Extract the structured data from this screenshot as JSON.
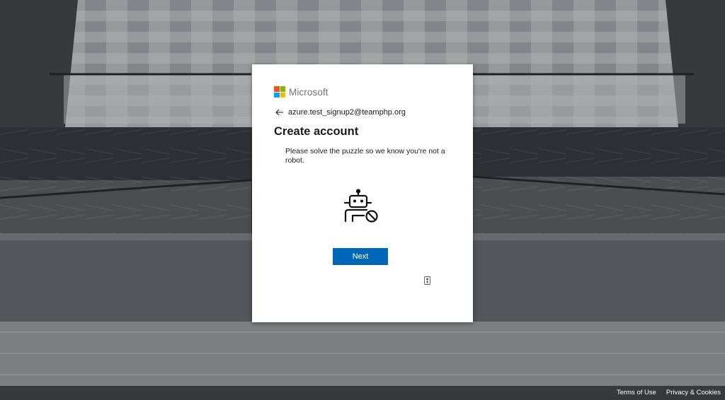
{
  "brand": {
    "name": "Microsoft",
    "colors": [
      "#f25022",
      "#7fba00",
      "#00a4ef",
      "#ffb900"
    ]
  },
  "card": {
    "identity": "azure.test_signup2@teamphp.org",
    "title": "Create account",
    "description": "Please solve the puzzle so we know you're not a robot.",
    "robot_icon": "robot-blocked-icon",
    "next_label": "Next",
    "next_color": "#0067b8",
    "audio_icon": "audio-challenge-icon"
  },
  "footer": {
    "terms": "Terms of Use",
    "privacy": "Privacy & Cookies"
  }
}
